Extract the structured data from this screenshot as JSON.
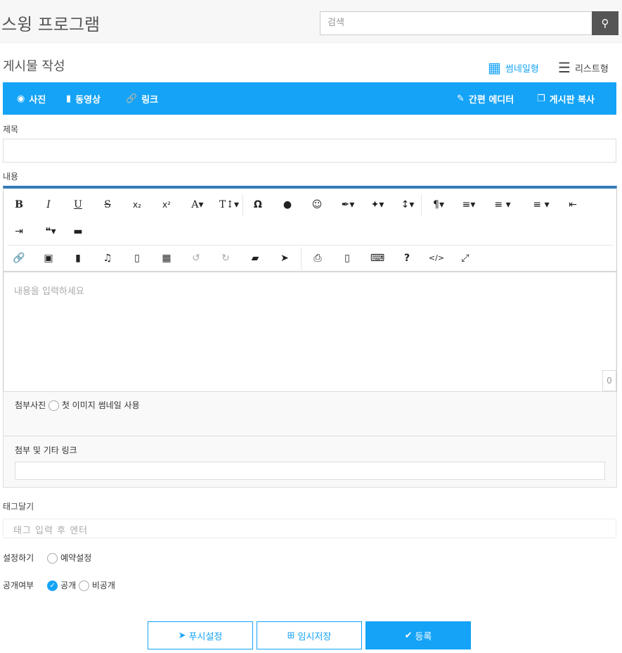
{
  "header": {
    "title": "스윙 프로그램",
    "search_placeholder": "검색"
  },
  "page": {
    "title": "게시물 작성",
    "view_thumbnail": "썸네일형",
    "view_list": "리스트형"
  },
  "bluebar": {
    "photo": "사진",
    "video": "동영상",
    "link": "링크",
    "simple_editor": "간편 에디터",
    "copy_board": "게시판 복사"
  },
  "form": {
    "subject_label": "제목",
    "content_label": "내용",
    "content_placeholder": "내용을 입력하세요",
    "char_count": "0",
    "attach_photo_label": "첨부사진",
    "first_image_thumb": "첫 이미지 썸네일 사용",
    "attach_link_label": "첨부 및 기타 링크",
    "tag_label": "태그달기",
    "tag_placeholder": "태그 입력 후 엔터",
    "setting_label": "설정하기",
    "reserve": "예약설정",
    "public_label": "공개여부",
    "public": "공개",
    "private": "비공개"
  },
  "buttons": {
    "push": "푸시설정",
    "temp_save": "임시저장",
    "submit": "등록"
  },
  "colors": {
    "accent": "#14a3f7",
    "editor_top": "#337ab7"
  }
}
